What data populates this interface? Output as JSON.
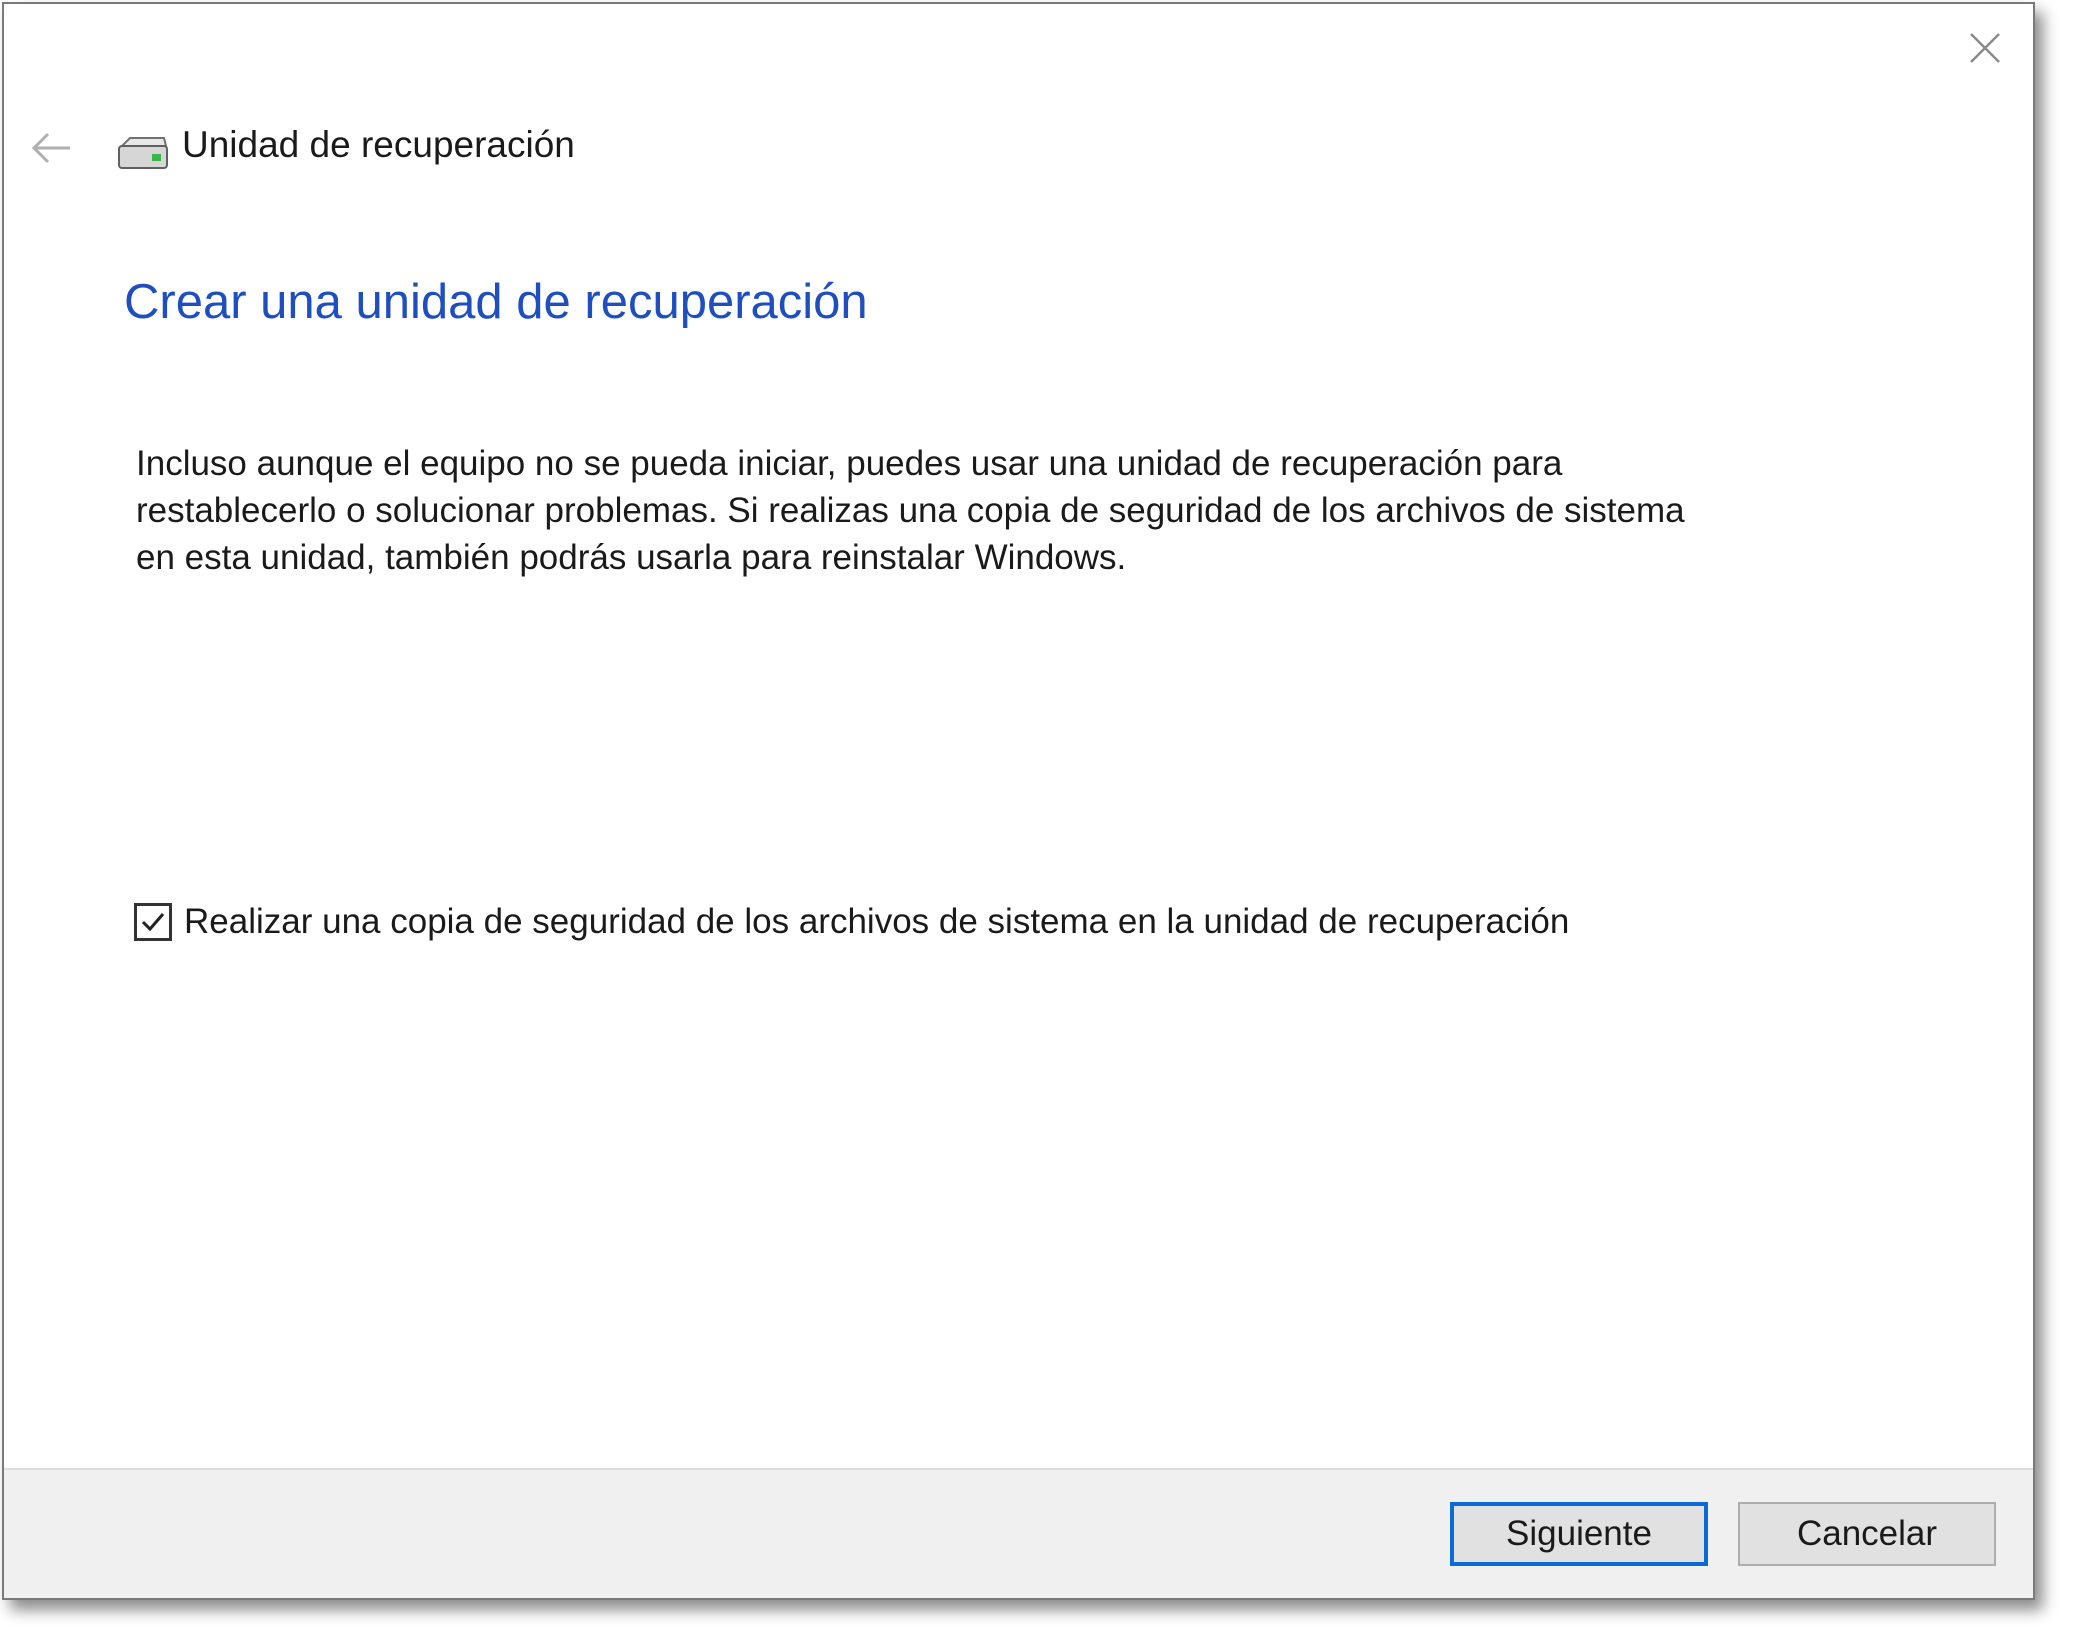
{
  "window": {
    "title": "Unidad de recuperación"
  },
  "header": {
    "back_icon": "arrow-left-icon",
    "drive_icon": "drive-icon",
    "close_icon": "close-icon"
  },
  "main": {
    "heading": "Crear una unidad de recuperación",
    "description": "Incluso aunque el equipo no se pueda iniciar, puedes usar una unidad de recuperación para restablecerlo o solucionar problemas. Si realizas una copia de seguridad de los archivos de sistema en esta unidad, también podrás usarla para reinstalar Windows.",
    "backup_checkbox": {
      "label": "Realizar una copia de seguridad de los archivos de sistema en la unidad de recuperación",
      "checked": true
    }
  },
  "footer": {
    "next_label": "Siguiente",
    "cancel_label": "Cancelar"
  },
  "colors": {
    "heading": "#1f4fbf",
    "default_button_border": "#0a6bd6",
    "footer_background": "#f0f0f0"
  }
}
